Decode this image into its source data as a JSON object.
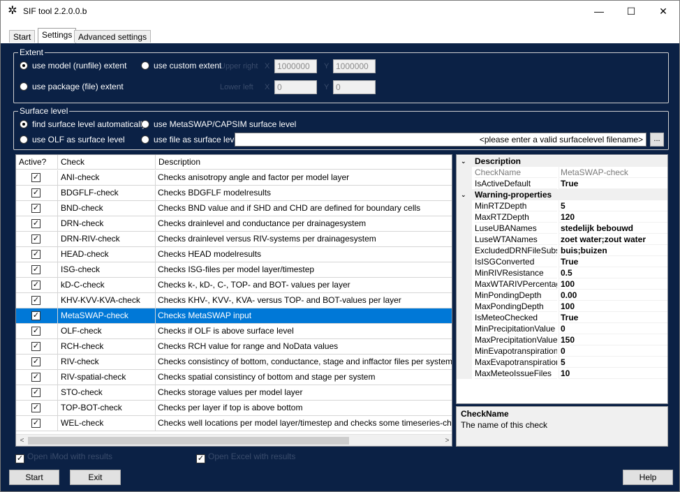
{
  "window": {
    "title": "SIF tool 2.2.0.0.b",
    "minimize_glyph": "—",
    "maximize_glyph": "☐",
    "close_glyph": "✕",
    "app_icon": "✲"
  },
  "tabs": [
    {
      "label": "Start",
      "active": false
    },
    {
      "label": "Settings",
      "active": true
    },
    {
      "label": "Advanced settings",
      "active": false
    }
  ],
  "extent": {
    "title": "Extent",
    "opt_model": "use model (runfile) extent",
    "opt_custom": "use custom extent",
    "opt_package": "use package (file) extent",
    "upper_right": "Upper right",
    "lower_left": "Lower left",
    "x": "X",
    "y": "Y",
    "ur_x": "1000000",
    "ur_y": "1000000",
    "ll_x": "0",
    "ll_y": "0"
  },
  "surface": {
    "title": "Surface level",
    "opt_auto": "find surface level automatically",
    "opt_metaswap": "use MetaSWAP/CAPSIM surface level",
    "opt_olf": "use OLF as surface level",
    "opt_file": "use file as surface level",
    "file_value": "<please enter a valid surfacelevel filename>",
    "browse": "..."
  },
  "grid": {
    "headers": [
      "Active?",
      "Check",
      "Description"
    ],
    "rows": [
      {
        "check": "ANI-check",
        "desc": "Checks anisotropy angle and factor per model layer"
      },
      {
        "check": "BDGFLF-check",
        "desc": "Checks BDGFLF modelresults"
      },
      {
        "check": "BND-check",
        "desc": "Checks BND value and if SHD and CHD are defined for boundary cells"
      },
      {
        "check": "DRN-check",
        "desc": "Checks drainlevel and conductance per drainagesystem"
      },
      {
        "check": "DRN-RIV-check",
        "desc": "Checks drainlevel versus RIV-systems per drainagesystem"
      },
      {
        "check": "HEAD-check",
        "desc": "Checks HEAD modelresults"
      },
      {
        "check": "ISG-check",
        "desc": "Checks ISG-files per model layer/timestep"
      },
      {
        "check": "kD-C-check",
        "desc": "Checks k-, kD-, C-, TOP- and BOT- values per layer"
      },
      {
        "check": "KHV-KVV-KVA-check",
        "desc": "Checks KHV-, KVV-, KVA- versus TOP- and BOT-values per layer"
      },
      {
        "check": "MetaSWAP-check",
        "desc": "Checks MetaSWAP input"
      },
      {
        "check": "OLF-check",
        "desc": "Checks if OLF is above surface level"
      },
      {
        "check": "RCH-check",
        "desc": "Checks RCH value for range and NoData values"
      },
      {
        "check": "RIV-check",
        "desc": "Checks consistincy of bottom, conductance, stage and inffactor files per system"
      },
      {
        "check": "RIV-spatial-check",
        "desc": "Checks spatial consistincy of bottom and stage per system"
      },
      {
        "check": "STO-check",
        "desc": "Checks storage values per model layer"
      },
      {
        "check": "TOP-BOT-check",
        "desc": "Checks per layer if top is above bottom"
      },
      {
        "check": "WEL-check",
        "desc": "Checks well locations per model layer/timestep and checks some timeseries-characteristic"
      }
    ],
    "checkmark": "✓",
    "scroll_left": "<",
    "scroll_right": ">"
  },
  "props": {
    "cat_description": "Description",
    "cat_warning": "Warning-properties",
    "collapse_glyph": "⌄",
    "description_rows": [
      {
        "k": "CheckName",
        "v": "MetaSWAP-check"
      },
      {
        "k": "IsActiveDefault",
        "v": "True"
      }
    ],
    "warning_rows": [
      {
        "k": "MinRTZDepth",
        "v": "5"
      },
      {
        "k": "MaxRTZDepth",
        "v": "120"
      },
      {
        "k": "LuseUBANames",
        "v": "stedelijk bebouwd"
      },
      {
        "k": "LuseWTANames",
        "v": "zoet water;zout water"
      },
      {
        "k": "ExcludedDRNFileSubstri",
        "v": "buis;buizen"
      },
      {
        "k": "IsISGConverted",
        "v": "True"
      },
      {
        "k": "MinRIVResistance",
        "v": "0.5"
      },
      {
        "k": "MaxWTARIVPercentage",
        "v": "100"
      },
      {
        "k": "MinPondingDepth",
        "v": "0.00"
      },
      {
        "k": "MaxPondingDepth",
        "v": "100"
      },
      {
        "k": "IsMeteoChecked",
        "v": "True"
      },
      {
        "k": "MinPrecipitationValue",
        "v": "0"
      },
      {
        "k": "MaxPrecipitationValue",
        "v": "150"
      },
      {
        "k": "MinEvapotranspirationVa",
        "v": "0"
      },
      {
        "k": "MaxEvapotranspirationVa",
        "v": "5"
      },
      {
        "k": "MaxMeteoIssueFiles",
        "v": "10"
      }
    ]
  },
  "help": {
    "title": "CheckName",
    "text": "The name of this check"
  },
  "options": {
    "open_imod": "Open iMod with results",
    "open_excel": "Open Excel with results"
  },
  "buttons": {
    "start": "Start",
    "exit": "Exit",
    "help": "Help"
  }
}
